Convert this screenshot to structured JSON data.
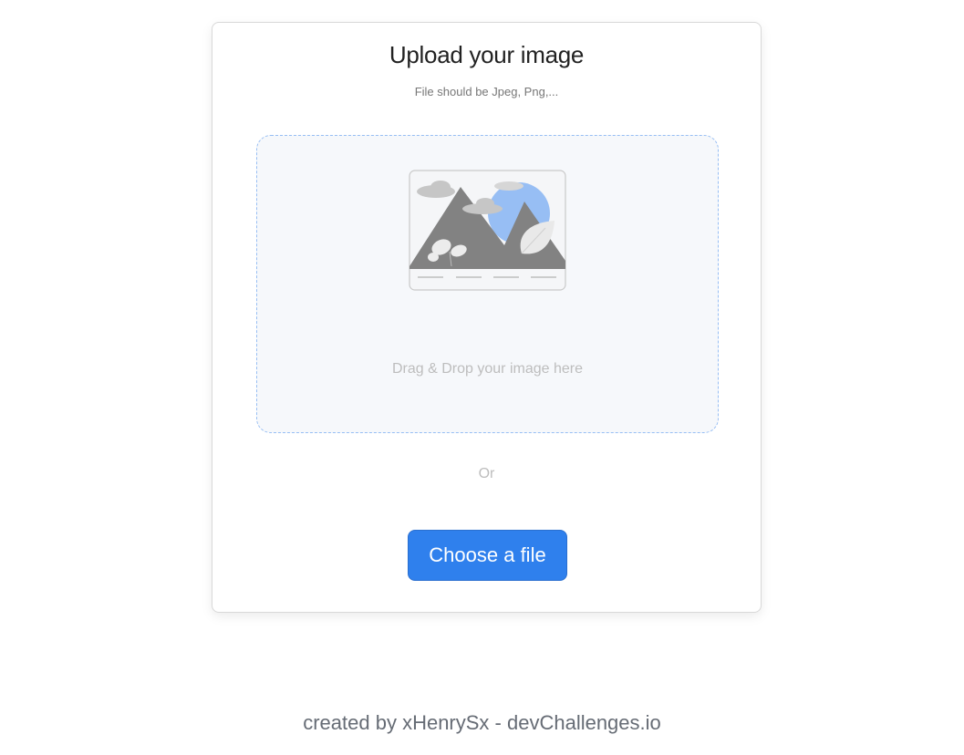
{
  "card": {
    "title": "Upload your image",
    "subtitle": "File should be Jpeg, Png,..."
  },
  "dropzone": {
    "illustration_icon": "image-placeholder-icon",
    "text": "Drag & Drop your image here"
  },
  "separator": "Or",
  "choose_button": {
    "label": "Choose a file"
  },
  "footer": {
    "text": "created by xHenrySx - devChallenges.io"
  },
  "colors": {
    "accent": "#2f80ed",
    "dropzone_border": "#97bef4",
    "dropzone_bg": "#f6f8fb"
  }
}
